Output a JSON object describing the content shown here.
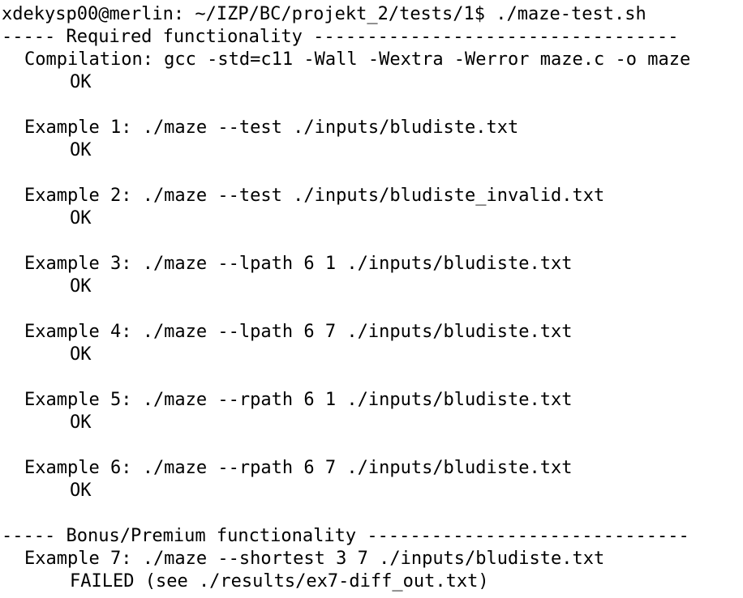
{
  "terminal": {
    "prompt": "xdekysp00@merlin: ~/IZP/BC/projekt_2/tests/1$ ./maze-test.sh",
    "required_header": "----- Required functionality ----------------------------------",
    "compilation": {
      "cmd": "Compilation: gcc -std=c11 -Wall -Wextra -Werror maze.c -o maze",
      "result": "OK"
    },
    "examples": [
      {
        "cmd": "Example 1: ./maze --test ./inputs/bludiste.txt",
        "result": "OK"
      },
      {
        "cmd": "Example 2: ./maze --test ./inputs/bludiste_invalid.txt",
        "result": "OK"
      },
      {
        "cmd": "Example 3: ./maze --lpath 6 1 ./inputs/bludiste.txt",
        "result": "OK"
      },
      {
        "cmd": "Example 4: ./maze --lpath 6 7 ./inputs/bludiste.txt",
        "result": "OK"
      },
      {
        "cmd": "Example 5: ./maze --rpath 6 1 ./inputs/bludiste.txt",
        "result": "OK"
      },
      {
        "cmd": "Example 6: ./maze --rpath 6 7 ./inputs/bludiste.txt",
        "result": "OK"
      }
    ],
    "bonus_header": "----- Bonus/Premium functionality ------------------------------",
    "bonus_examples": [
      {
        "cmd": "Example 7: ./maze --shortest 3 7 ./inputs/bludiste.txt",
        "result": "FAILED (see ./results/ex7-diff_out.txt)"
      }
    ]
  }
}
